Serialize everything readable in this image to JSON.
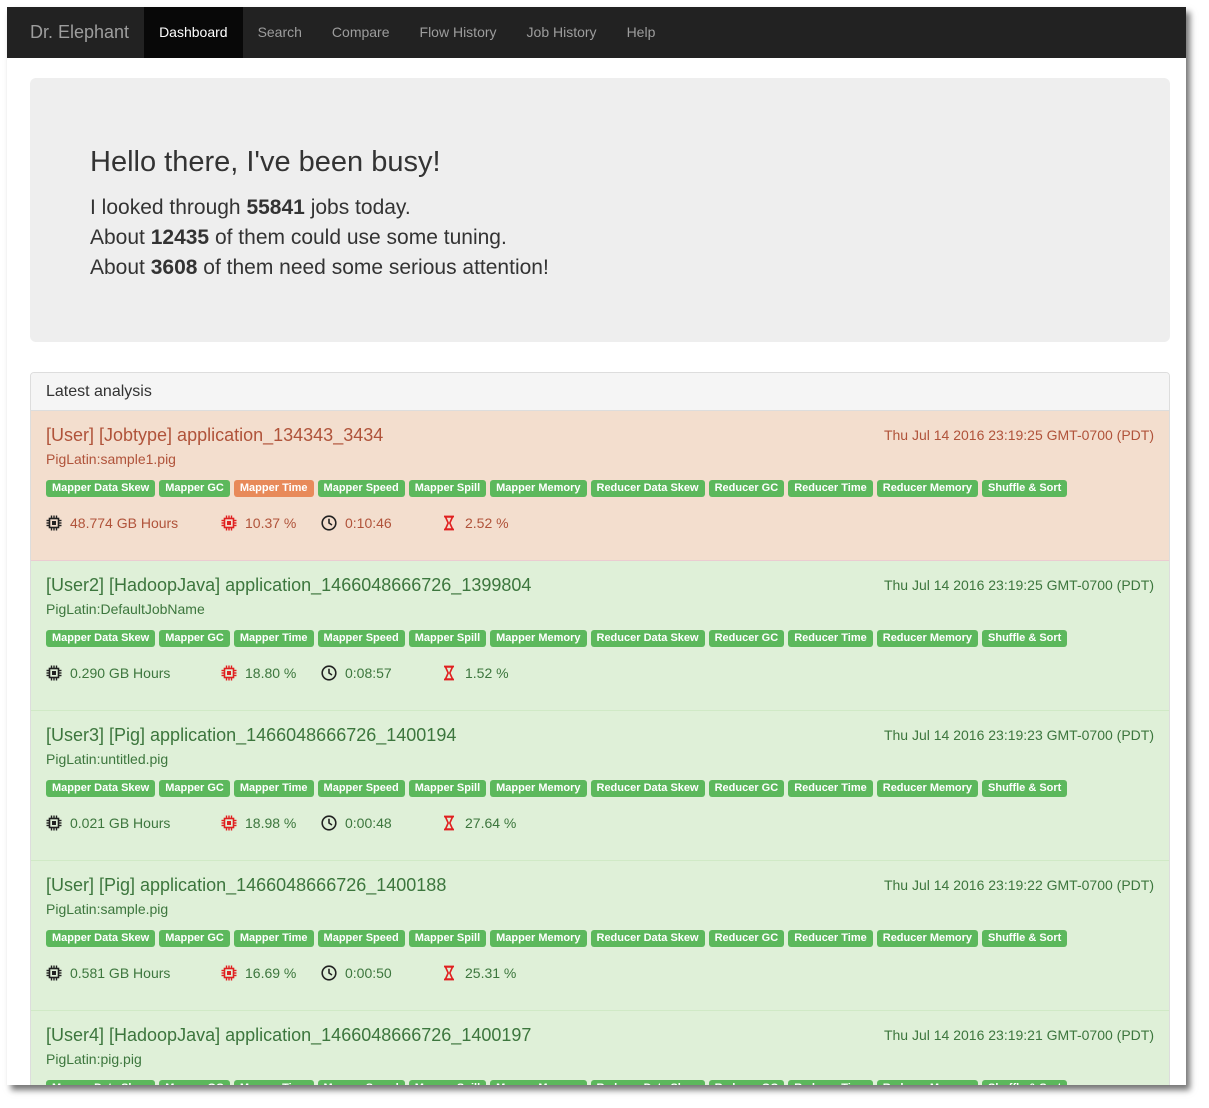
{
  "navbar": {
    "brand": "Dr. Elephant",
    "items": [
      {
        "label": "Dashboard",
        "active": true
      },
      {
        "label": "Search"
      },
      {
        "label": "Compare"
      },
      {
        "label": "Flow History"
      },
      {
        "label": "Job History"
      },
      {
        "label": "Help"
      }
    ]
  },
  "hero": {
    "title": "Hello there, I've been busy!",
    "line1_pre": "I looked through ",
    "line1_num": "55841",
    "line1_post": " jobs today.",
    "line2_pre": "About ",
    "line2_num": "12435",
    "line2_post": " of them could use some tuning.",
    "line3_pre": "About ",
    "line3_num": "3608",
    "line3_post": " of them need some serious attention!"
  },
  "panel": {
    "heading": "Latest analysis"
  },
  "heuristics": [
    "Mapper Data Skew",
    "Mapper GC",
    "Mapper Time",
    "Mapper Speed",
    "Mapper Spill",
    "Mapper Memory",
    "Reducer Data Skew",
    "Reducer GC",
    "Reducer Time",
    "Reducer Memory",
    "Shuffle & Sort"
  ],
  "colors": {
    "badge_ok": "#5cb85c",
    "badge_bad": "#e88a5a",
    "row_ok_bg": "#dff0d8",
    "row_warn_bg": "#f3dece",
    "cpu_icon_red": "#e02020"
  },
  "jobs": [
    {
      "status": "warn",
      "title": "[User] [Jobtype] application_134343_3434",
      "time": "Thu Jul 14 2016 23:19:25 GMT-0700 (PDT)",
      "sub": "PigLatin:sample1.pig",
      "bad_badges": [
        "Mapper Time"
      ],
      "resource": "48.774 GB Hours",
      "cpu": "10.37 %",
      "runtime": "0:10:46",
      "wait": "2.52 %"
    },
    {
      "status": "ok",
      "title": "[User2] [HadoopJava] application_1466048666726_1399804",
      "time": "Thu Jul 14 2016 23:19:25 GMT-0700 (PDT)",
      "sub": "PigLatin:DefaultJobName",
      "bad_badges": [],
      "resource": "0.290 GB Hours",
      "cpu": "18.80 %",
      "runtime": "0:08:57",
      "wait": "1.52 %"
    },
    {
      "status": "ok",
      "title": "[User3] [Pig] application_1466048666726_1400194",
      "time": "Thu Jul 14 2016 23:19:23 GMT-0700 (PDT)",
      "sub": "PigLatin:untitled.pig",
      "bad_badges": [],
      "resource": "0.021 GB Hours",
      "cpu": "18.98 %",
      "runtime": "0:00:48",
      "wait": "27.64 %"
    },
    {
      "status": "ok",
      "title": "[User] [Pig] application_1466048666726_1400188",
      "time": "Thu Jul 14 2016 23:19:22 GMT-0700 (PDT)",
      "sub": "PigLatin:sample.pig",
      "bad_badges": [],
      "resource": "0.581 GB Hours",
      "cpu": "16.69 %",
      "runtime": "0:00:50",
      "wait": "25.31 %"
    },
    {
      "status": "ok",
      "title": "[User4] [HadoopJava] application_1466048666726_1400197",
      "time": "Thu Jul 14 2016 23:19:21 GMT-0700 (PDT)",
      "sub": "PigLatin:pig.pig",
      "bad_badges": [],
      "resource": "",
      "cpu": "",
      "runtime": "",
      "wait": ""
    }
  ]
}
